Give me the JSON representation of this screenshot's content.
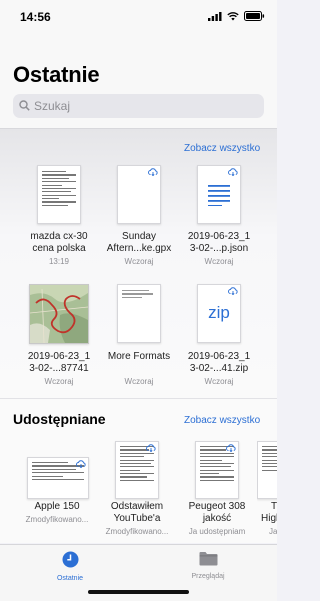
{
  "status": {
    "time": "14:56"
  },
  "header": {
    "title": "Ostatnie",
    "search_placeholder": "Szukaj"
  },
  "recent": {
    "see_all": "Zobacz wszystko",
    "items": [
      {
        "name1": "mazda cx-30",
        "name2": "cena polska",
        "meta": "13:19",
        "kind": "document",
        "cloud": false
      },
      {
        "name1": "Sunday",
        "name2": "Aftern...ke.gpx",
        "meta": "Wczoraj",
        "kind": "blank",
        "cloud": true
      },
      {
        "name1": "2019-06-23_1",
        "name2": "3-02-...p.json",
        "meta": "Wczoraj",
        "kind": "lines",
        "cloud": true
      },
      {
        "name1": "2019-06-23_1",
        "name2": "3-02-...87741",
        "meta": "Wczoraj",
        "kind": "map",
        "cloud": false
      },
      {
        "name1": "More Formats",
        "name2": "",
        "meta": "Wczoraj",
        "kind": "text-short",
        "cloud": false
      },
      {
        "name1": "2019-06-23_1",
        "name2": "3-02-...41.zip",
        "meta": "Wczoraj",
        "kind": "zip",
        "cloud": true,
        "label": "zip"
      }
    ]
  },
  "shared": {
    "title": "Udostępniane",
    "see_all": "Zobacz wszystko",
    "items": [
      {
        "name1": "Apple 150",
        "name2": "",
        "meta": "Zmodyfikowano..."
      },
      {
        "name1": "Odstawiłem",
        "name2": "YouTube'a",
        "meta": "Zmodyfikowano..."
      },
      {
        "name1": "Peugeot 308",
        "name2": "jakość",
        "meta": "Ja udostępniam"
      },
      {
        "name1": "T",
        "name2": "High",
        "meta": "Ja"
      }
    ]
  },
  "tabs": [
    {
      "label": "Ostatnie",
      "active": true,
      "color": "#2c6fd4"
    },
    {
      "label": "Przeglądaj",
      "active": false,
      "color": "#8e8e93"
    }
  ]
}
